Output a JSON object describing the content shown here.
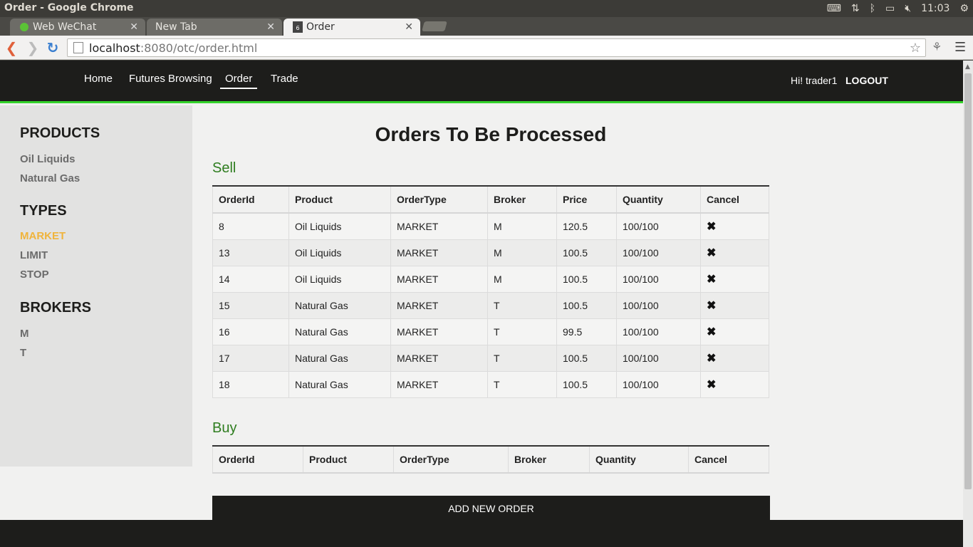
{
  "os": {
    "window_title": "Order - Google Chrome",
    "clock": "11:03"
  },
  "tabs": [
    {
      "label": "Web WeChat",
      "active": false
    },
    {
      "label": "New Tab",
      "active": false
    },
    {
      "label": "Order",
      "active": true
    }
  ],
  "toolbar": {
    "url_host": "localhost",
    "url_path": ":8080/otc/order.html"
  },
  "site": {
    "nav": [
      "Home",
      "Futures Browsing",
      "Order",
      "Trade"
    ],
    "active_nav": "Order",
    "greeting": "Hi! trader1",
    "logout": "LOGOUT",
    "accent_color": "#34d32b"
  },
  "sidebar": {
    "products_heading": "PRODUCTS",
    "products": [
      "Oil Liquids",
      "Natural Gas"
    ],
    "types_heading": "TYPES",
    "types": [
      "MARKET",
      "LIMIT",
      "STOP"
    ],
    "active_type": "MARKET",
    "brokers_heading": "BROKERS",
    "brokers": [
      "M",
      "T"
    ]
  },
  "main": {
    "title": "Orders To Be Processed",
    "sell": {
      "title": "Sell",
      "columns": [
        "OrderId",
        "Product",
        "OrderType",
        "Broker",
        "Price",
        "Quantity",
        "Cancel"
      ],
      "rows": [
        [
          "8",
          "Oil Liquids",
          "MARKET",
          "M",
          "120.5",
          "100/100"
        ],
        [
          "13",
          "Oil Liquids",
          "MARKET",
          "M",
          "100.5",
          "100/100"
        ],
        [
          "14",
          "Oil Liquids",
          "MARKET",
          "M",
          "100.5",
          "100/100"
        ],
        [
          "15",
          "Natural Gas",
          "MARKET",
          "T",
          "100.5",
          "100/100"
        ],
        [
          "16",
          "Natural Gas",
          "MARKET",
          "T",
          "99.5",
          "100/100"
        ],
        [
          "17",
          "Natural Gas",
          "MARKET",
          "T",
          "100.5",
          "100/100"
        ],
        [
          "18",
          "Natural Gas",
          "MARKET",
          "T",
          "100.5",
          "100/100"
        ]
      ]
    },
    "buy": {
      "title": "Buy",
      "columns": [
        "OrderId",
        "Product",
        "OrderType",
        "Broker",
        "Quantity",
        "Cancel"
      ],
      "rows": []
    },
    "add_button": "ADD NEW ORDER"
  }
}
